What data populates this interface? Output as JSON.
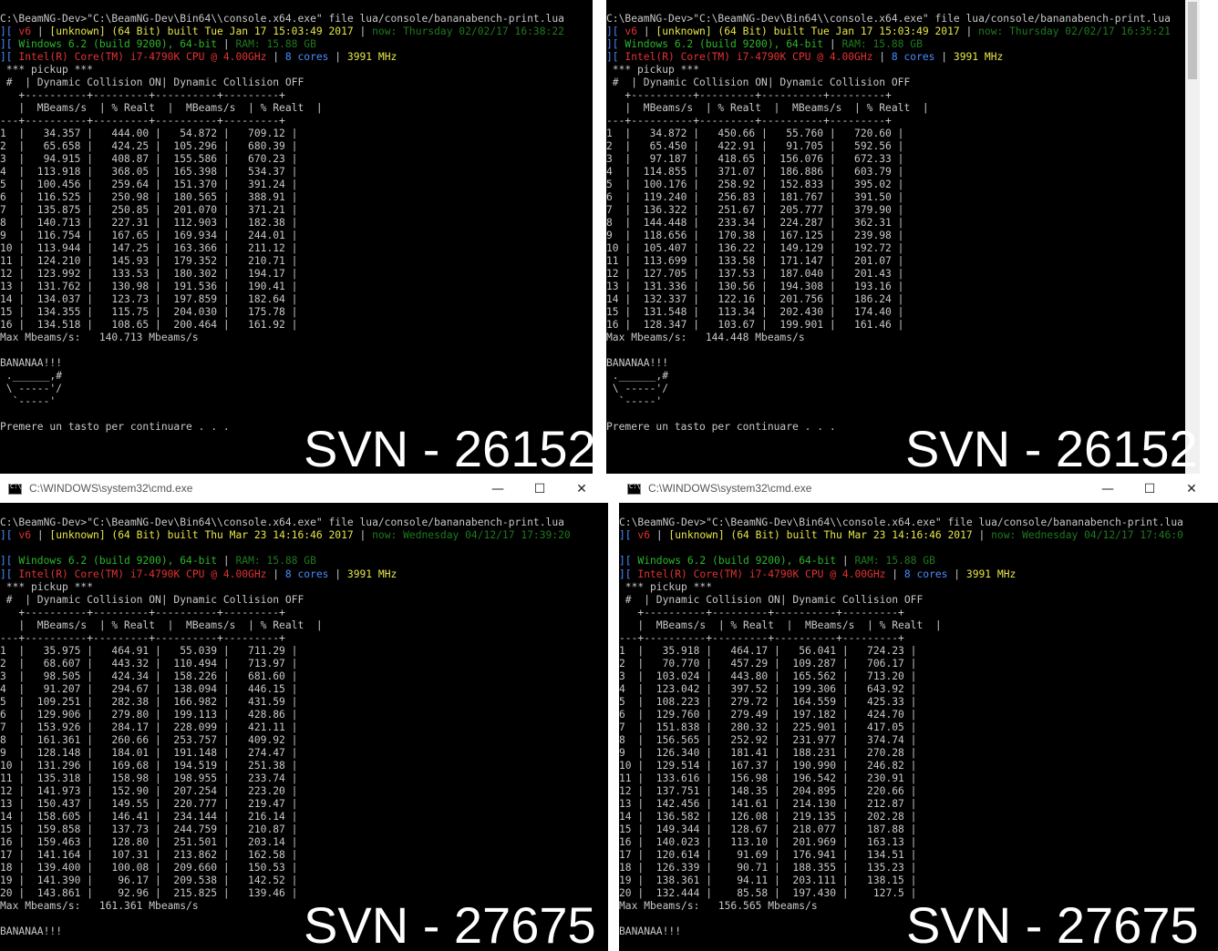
{
  "panes": [
    {
      "id": "p1",
      "has_titlebar": false,
      "command": "C:\\BeamNG-Dev>\"C:\\BeamNG-Dev\\Bin64\\\\console.x64.exe\" file lua/console/bananabench-print.lua",
      "info1": {
        "ver": "v6",
        "build": "[unknown] (64 Bit) built Tue Jan 17 15:03:49 2017",
        "now": "now: Thursday 02/02/17 16:38:22"
      },
      "info2": {
        "os": "Windows 6.2 (build 9200), 64-bit",
        "ram": "RAM: 15.88 GB"
      },
      "info3": {
        "cpu": "Intel(R) Core(TM) i7-4790K CPU @ 4.00GHz",
        "cores": "8 cores",
        "mhz": "3991 MHz"
      },
      "rows": [
        [
          "1",
          "34.357",
          "444.00",
          "54.872",
          "709.12"
        ],
        [
          "2",
          "65.658",
          "424.25",
          "105.296",
          "680.39"
        ],
        [
          "3",
          "94.915",
          "408.87",
          "155.586",
          "670.23"
        ],
        [
          "4",
          "113.918",
          "368.05",
          "165.398",
          "534.37"
        ],
        [
          "5",
          "100.456",
          "259.64",
          "151.370",
          "391.24"
        ],
        [
          "6",
          "116.525",
          "250.98",
          "180.565",
          "388.91"
        ],
        [
          "7",
          "135.875",
          "250.85",
          "201.070",
          "371.21"
        ],
        [
          "8",
          "140.713",
          "227.31",
          "112.903",
          "182.38"
        ],
        [
          "9",
          "116.754",
          "167.65",
          "169.934",
          "244.01"
        ],
        [
          "10",
          "113.944",
          "147.25",
          "163.366",
          "211.12"
        ],
        [
          "11",
          "124.210",
          "145.93",
          "179.352",
          "210.71"
        ],
        [
          "12",
          "123.992",
          "133.53",
          "180.302",
          "194.17"
        ],
        [
          "13",
          "131.762",
          "130.98",
          "191.536",
          "190.41"
        ],
        [
          "14",
          "134.037",
          "123.73",
          "197.859",
          "182.64"
        ],
        [
          "15",
          "134.355",
          "115.75",
          "204.030",
          "175.78"
        ],
        [
          "16",
          "134.518",
          "108.65",
          "200.464",
          "161.92"
        ]
      ],
      "max_line": "Max Mbeams/s:   140.713 Mbeams/s",
      "tail": [
        "",
        "BANANAA!!!",
        " .______,#",
        " \\ -----'/",
        "  `-----'",
        "",
        "Premere un tasto per continuare . . ."
      ],
      "svn": "SVN - 26152"
    },
    {
      "id": "p2",
      "has_titlebar": false,
      "command": "C:\\BeamNG-Dev>\"C:\\BeamNG-Dev\\Bin64\\\\console.x64.exe\" file lua/console/bananabench-print.lua",
      "info1": {
        "ver": "v6",
        "build": "[unknown] (64 Bit) built Tue Jan 17 15:03:49 2017",
        "now": "now: Thursday 02/02/17 16:35:21"
      },
      "info2": {
        "os": "Windows 6.2 (build 9200), 64-bit",
        "ram": "RAM: 15.88 GB"
      },
      "info3": {
        "cpu": "Intel(R) Core(TM) i7-4790K CPU @ 4.00GHz",
        "cores": "8 cores",
        "mhz": "3991 MHz"
      },
      "rows": [
        [
          "1",
          "34.872",
          "450.66",
          "55.760",
          "720.60"
        ],
        [
          "2",
          "65.450",
          "422.91",
          "91.705",
          "592.56"
        ],
        [
          "3",
          "97.187",
          "418.65",
          "156.076",
          "672.33"
        ],
        [
          "4",
          "114.855",
          "371.07",
          "186.886",
          "603.79"
        ],
        [
          "5",
          "100.176",
          "258.92",
          "152.833",
          "395.02"
        ],
        [
          "6",
          "119.240",
          "256.83",
          "181.767",
          "391.50"
        ],
        [
          "7",
          "136.322",
          "251.67",
          "205.777",
          "379.90"
        ],
        [
          "8",
          "144.448",
          "233.34",
          "224.287",
          "362.31"
        ],
        [
          "9",
          "118.656",
          "170.38",
          "167.125",
          "239.98"
        ],
        [
          "10",
          "105.407",
          "136.22",
          "149.129",
          "192.72"
        ],
        [
          "11",
          "113.699",
          "133.58",
          "171.147",
          "201.07"
        ],
        [
          "12",
          "127.705",
          "137.53",
          "187.040",
          "201.43"
        ],
        [
          "13",
          "131.336",
          "130.56",
          "194.308",
          "193.16"
        ],
        [
          "14",
          "132.337",
          "122.16",
          "201.756",
          "186.24"
        ],
        [
          "15",
          "131.548",
          "113.34",
          "202.430",
          "174.40"
        ],
        [
          "16",
          "128.347",
          "103.67",
          "199.901",
          "161.46"
        ]
      ],
      "max_line": "Max Mbeams/s:   144.448 Mbeams/s",
      "tail": [
        "",
        "BANANAA!!!",
        " .______,#",
        " \\ -----'/",
        "  `-----'",
        "",
        "Premere un tasto per continuare . . ."
      ],
      "svn": "SVN - 26152"
    },
    {
      "id": "p3",
      "has_titlebar": true,
      "title": "C:\\WINDOWS\\system32\\cmd.exe",
      "command": "C:\\BeamNG-Dev>\"C:\\BeamNG-Dev\\Bin64\\\\console.x64.exe\" file lua/console/bananabench-print.lua",
      "info1": {
        "ver": "v6",
        "build": "[unknown] (64 Bit) built Thu Mar 23 14:16:46 2017",
        "now": "now: Wednesday 04/12/17 17:39:20"
      },
      "info2": {
        "os": "Windows 6.2 (build 9200), 64-bit",
        "ram": "RAM: 15.88 GB"
      },
      "info3": {
        "cpu": "Intel(R) Core(TM) i7-4790K CPU @ 4.00GHz",
        "cores": "8 cores",
        "mhz": "3991 MHz"
      },
      "rows": [
        [
          "1",
          "35.975",
          "464.91",
          "55.039",
          "711.29"
        ],
        [
          "2",
          "68.607",
          "443.32",
          "110.494",
          "713.97"
        ],
        [
          "3",
          "98.505",
          "424.34",
          "158.226",
          "681.60"
        ],
        [
          "4",
          "91.207",
          "294.67",
          "138.094",
          "446.15"
        ],
        [
          "5",
          "109.251",
          "282.38",
          "166.982",
          "431.59"
        ],
        [
          "6",
          "129.906",
          "279.80",
          "199.113",
          "428.86"
        ],
        [
          "7",
          "153.926",
          "284.17",
          "228.099",
          "421.11"
        ],
        [
          "8",
          "161.361",
          "260.66",
          "253.757",
          "409.92"
        ],
        [
          "9",
          "128.148",
          "184.01",
          "191.148",
          "274.47"
        ],
        [
          "10",
          "131.296",
          "169.68",
          "194.519",
          "251.38"
        ],
        [
          "11",
          "135.318",
          "158.98",
          "198.955",
          "233.74"
        ],
        [
          "12",
          "141.973",
          "152.90",
          "207.254",
          "223.20"
        ],
        [
          "13",
          "150.437",
          "149.55",
          "220.777",
          "219.47"
        ],
        [
          "14",
          "158.605",
          "146.41",
          "234.144",
          "216.14"
        ],
        [
          "15",
          "159.858",
          "137.73",
          "244.759",
          "210.87"
        ],
        [
          "16",
          "159.463",
          "128.80",
          "251.501",
          "203.14"
        ],
        [
          "17",
          "141.164",
          "107.31",
          "213.862",
          "162.58"
        ],
        [
          "18",
          "139.400",
          "100.08",
          "209.660",
          "150.53"
        ],
        [
          "19",
          "141.390",
          "96.17",
          "209.538",
          "142.52"
        ],
        [
          "20",
          "143.861",
          "92.96",
          "215.825",
          "139.46"
        ]
      ],
      "max_line": "Max Mbeams/s:   161.361 Mbeams/s",
      "tail": [
        "",
        "BANANAA!!!"
      ],
      "svn": "SVN - 27675"
    },
    {
      "id": "p4",
      "has_titlebar": true,
      "title": "C:\\WINDOWS\\system32\\cmd.exe",
      "command": "C:\\BeamNG-Dev>\"C:\\BeamNG-Dev\\Bin64\\\\console.x64.exe\" file lua/console/bananabench-print.lua",
      "info1": {
        "ver": "v6",
        "build": "[unknown] (64 Bit) built Thu Mar 23 14:16:46 2017",
        "now": "now: Wednesday 04/12/17 17:46:0"
      },
      "info2": {
        "os": "Windows 6.2 (build 9200), 64-bit",
        "ram": "RAM: 15.88 GB"
      },
      "info3": {
        "cpu": "Intel(R) Core(TM) i7-4790K CPU @ 4.00GHz",
        "cores": "8 cores",
        "mhz": "3991 MHz"
      },
      "rows": [
        [
          "1",
          "35.918",
          "464.17",
          "56.041",
          "724.23"
        ],
        [
          "2",
          "70.770",
          "457.29",
          "109.287",
          "706.17"
        ],
        [
          "3",
          "103.024",
          "443.80",
          "165.562",
          "713.20"
        ],
        [
          "4",
          "123.042",
          "397.52",
          "199.306",
          "643.92"
        ],
        [
          "5",
          "108.223",
          "279.72",
          "164.559",
          "425.33"
        ],
        [
          "6",
          "129.760",
          "279.49",
          "197.182",
          "424.70"
        ],
        [
          "7",
          "151.838",
          "280.32",
          "225.901",
          "417.05"
        ],
        [
          "8",
          "156.565",
          "252.92",
          "231.977",
          "374.74"
        ],
        [
          "9",
          "126.340",
          "181.41",
          "188.231",
          "270.28"
        ],
        [
          "10",
          "129.514",
          "167.37",
          "190.990",
          "246.82"
        ],
        [
          "11",
          "133.616",
          "156.98",
          "196.542",
          "230.91"
        ],
        [
          "12",
          "137.751",
          "148.35",
          "204.895",
          "220.66"
        ],
        [
          "13",
          "142.456",
          "141.61",
          "214.130",
          "212.87"
        ],
        [
          "14",
          "136.582",
          "126.08",
          "219.135",
          "202.28"
        ],
        [
          "15",
          "149.344",
          "128.67",
          "218.077",
          "187.88"
        ],
        [
          "16",
          "140.023",
          "113.10",
          "201.969",
          "163.13"
        ],
        [
          "17",
          "120.614",
          "91.69",
          "176.941",
          "134.51"
        ],
        [
          "18",
          "126.339",
          "90.71",
          "188.355",
          "135.23"
        ],
        [
          "19",
          "138.361",
          "94.11",
          "203.111",
          "138.15"
        ],
        [
          "20",
          "132.444",
          "85.58",
          "197.430",
          "127.5"
        ]
      ],
      "max_line": "Max Mbeams/s:   156.565 Mbeams/s",
      "tail": [
        "",
        "BANANAA!!!"
      ],
      "svn": "SVN - 27675"
    }
  ],
  "table": {
    "section": " *** pickup ***",
    "header1": " #  | Dynamic Collision ON| Dynamic Collision OFF",
    "rule": "   +----------+---------+----------+---------+",
    "header2": "   |  MBeams/s  | % Realt  |  MBeams/s  | % Realt  |",
    "rule2": "---+----------+---------+----------+---------+"
  },
  "window_buttons": {
    "minimize": "—",
    "maximize": "☐",
    "close": "✕"
  },
  "colors": {
    "green": "#2db62d",
    "dark_green": "#1e7a1e",
    "red": "#e23232",
    "yellow": "#e6e64a",
    "blue": "#4a8cff",
    "grey": "#c8c8c8"
  }
}
